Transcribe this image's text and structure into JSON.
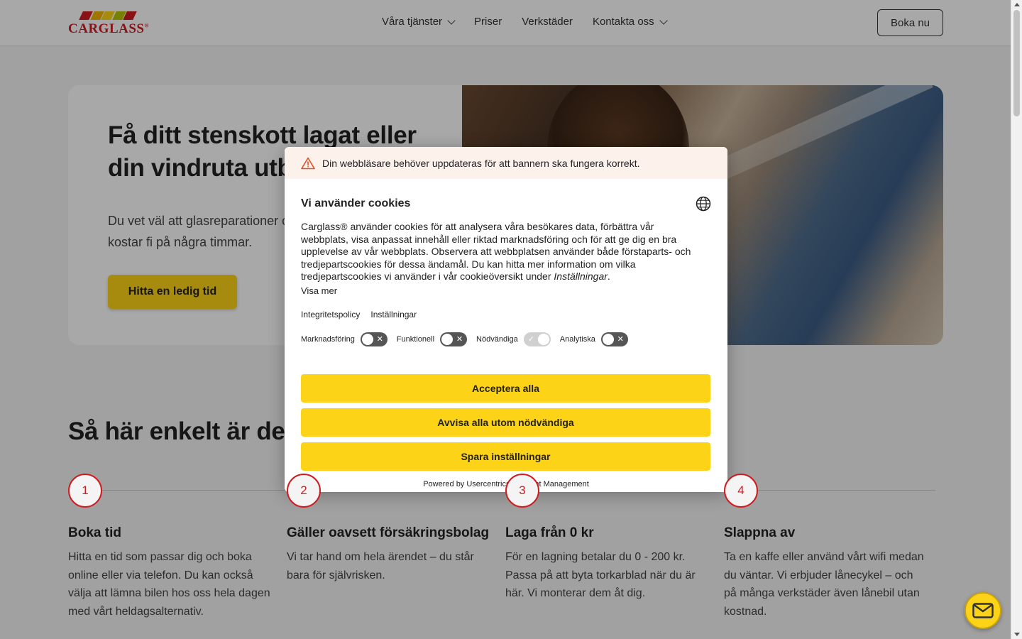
{
  "header": {
    "logo_text": "CARGLASS",
    "logo_mark": "®",
    "nav": [
      {
        "label": "Våra tjänster",
        "has_dropdown": true
      },
      {
        "label": "Priser",
        "has_dropdown": false
      },
      {
        "label": "Verkstäder",
        "has_dropdown": false
      },
      {
        "label": "Kontakta oss",
        "has_dropdown": true
      }
    ],
    "cta_label": "Boka nu"
  },
  "hero": {
    "title": "Få ditt stenskott lagat eller din vindruta utbytt",
    "subtitle": "Du vet väl att glasreparationer o självrisken? En lagning kostar fi på några timmar.",
    "button_label": "Hitta en ledig tid"
  },
  "steps": {
    "title": "Så här enkelt är det",
    "items": [
      {
        "number": "1",
        "title": "Boka tid",
        "text": "Hitta en tid som passar dig och boka online eller via telefon. Du kan också välja att lämna bilen hos oss hela dagen med vårt heldagsalternativ."
      },
      {
        "number": "2",
        "title": "Gäller oavsett försäkringsbolag",
        "text": "Vi tar hand om hela ärendet – du står bara för självrisken."
      },
      {
        "number": "3",
        "title": "Laga från 0 kr",
        "text": "För en lagning betalar du 0 - 200 kr. Passa på att byta torkarblad när du är här. Vi monterar dem åt dig."
      },
      {
        "number": "4",
        "title": "Slappna av",
        "text": "Ta en kaffe eller använd vårt wifi medan du väntar. Vi erbjuder lånecykel – och på många verkstäder även lånebil utan kostnad."
      }
    ]
  },
  "cookie": {
    "warning": "Din webbläsare behöver uppdateras för att bannern ska fungera korrekt.",
    "title": "Vi använder cookies",
    "description": "Carglass® använder cookies för att analysera våra besökares data, förbättra vår webbplats, visa anpassat innehåll eller riktad marknadsföring och för att ge dig en bra upplevelse av vår webbplats. Observera att webbplatsen använder både förstaparts- och tredjepartscookies för dessa ändamål. Du kan hitta mer information om vilka tredjepartscookies vi använder i vår cookieöversikt under",
    "description_link": "Inställningar",
    "description_end": ".",
    "show_more": "Visa mer",
    "links": [
      "Integritetspolicy",
      "Inställningar"
    ],
    "toggles": [
      {
        "label": "Marknadsföring",
        "on": false
      },
      {
        "label": "Funktionell",
        "on": false
      },
      {
        "label": "Nödvändiga",
        "on": true
      },
      {
        "label": "Analytiska",
        "on": false
      }
    ],
    "buttons": {
      "accept_all": "Acceptera alla",
      "reject_all": "Avvisa alla utom nödvändiga",
      "save": "Spara inställningar"
    },
    "powered_by": "Powered by Usercentrics Consent Management"
  },
  "colors": {
    "brand_red": "#d01c20",
    "accent_yellow": "#fdd317"
  },
  "icons": {
    "warning": "warning-triangle-icon",
    "language": "globe-icon",
    "chat": "mail-icon"
  }
}
